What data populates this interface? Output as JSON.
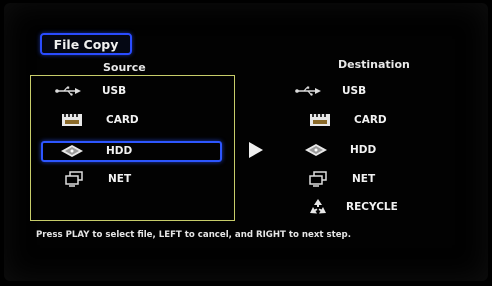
{
  "dialog": {
    "title": "File Copy"
  },
  "source": {
    "header": "Source",
    "items": [
      {
        "label": "USB",
        "icon": "usb-icon"
      },
      {
        "label": "CARD",
        "icon": "card-icon"
      },
      {
        "label": "HDD",
        "icon": "hdd-icon"
      },
      {
        "label": "NET",
        "icon": "network-icon"
      }
    ],
    "selected": "HDD"
  },
  "destination": {
    "header": "Destination",
    "items": [
      {
        "label": "USB",
        "icon": "usb-icon"
      },
      {
        "label": "CARD",
        "icon": "card-icon"
      },
      {
        "label": "HDD",
        "icon": "hdd-icon"
      },
      {
        "label": "NET",
        "icon": "network-icon"
      },
      {
        "label": "RECYCLE",
        "icon": "recycle-icon"
      }
    ]
  },
  "help_text": "Press PLAY to select file, LEFT to cancel, and RIGHT to next step.",
  "colors": {
    "accent": "#2d56ff",
    "panel_border": "#c7cc6a",
    "background": "#000000",
    "text": "#f2f2f2"
  }
}
